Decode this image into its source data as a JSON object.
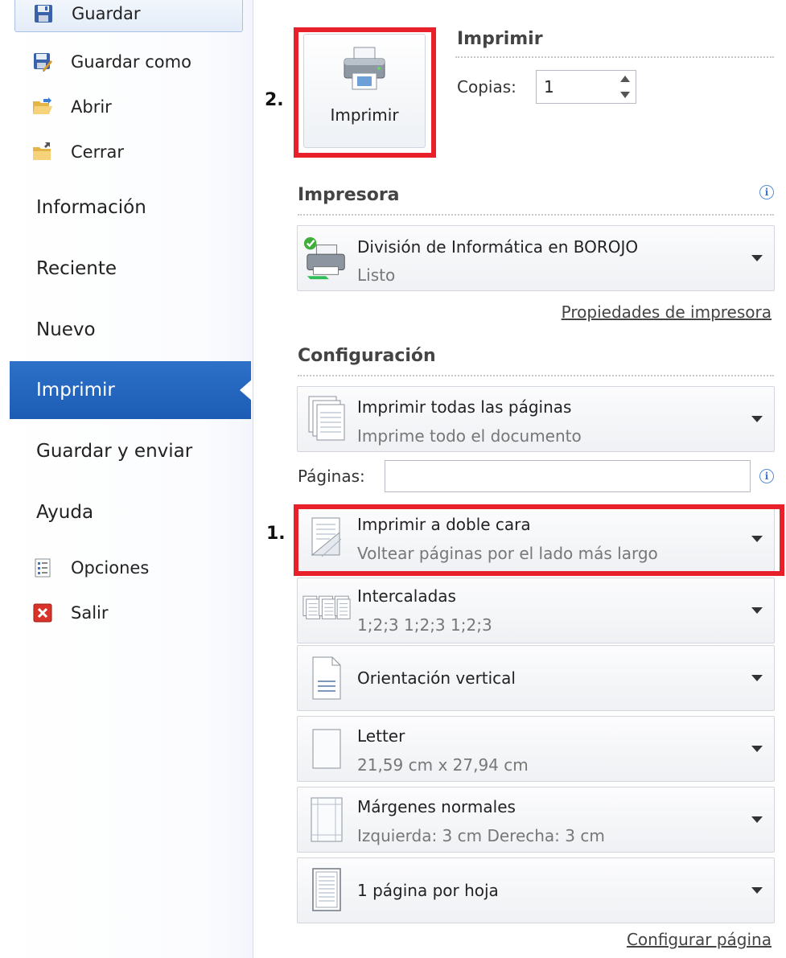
{
  "sidebar": {
    "commands": [
      {
        "label": "Guardar",
        "icon": "save-icon"
      },
      {
        "label": "Guardar como",
        "icon": "save-as-icon"
      },
      {
        "label": "Abrir",
        "icon": "open-folder-icon"
      },
      {
        "label": "Cerrar",
        "icon": "close-folder-icon"
      }
    ],
    "tabs": [
      {
        "label": "Información"
      },
      {
        "label": "Reciente"
      },
      {
        "label": "Nuevo"
      },
      {
        "label": "Imprimir"
      },
      {
        "label": "Guardar y enviar"
      },
      {
        "label": "Ayuda"
      }
    ],
    "footer": [
      {
        "label": "Opciones",
        "icon": "options-icon"
      },
      {
        "label": "Salir",
        "icon": "exit-icon"
      }
    ]
  },
  "print": {
    "section_title": "Imprimir",
    "button_label": "Imprimir",
    "copies_label": "Copias:",
    "copies_value": "1"
  },
  "printer": {
    "section_title": "Impresora",
    "name": "División de Informática en BOROJO",
    "status": "Listo",
    "properties_link": "Propiedades de impresora"
  },
  "settings": {
    "section_title": "Configuración",
    "pages_label": "Páginas:",
    "pages_value": "",
    "options": [
      {
        "main": "Imprimir todas las páginas",
        "sub": "Imprime todo el documento",
        "icon": "all-pages-icon"
      },
      {
        "main": "Imprimir a doble cara",
        "sub": "Voltear páginas por el lado más largo",
        "icon": "duplex-icon"
      },
      {
        "main": "Intercaladas",
        "sub": "1;2;3    1;2;3    1;2;3",
        "icon": "collated-icon"
      },
      {
        "main": "Orientación vertical",
        "sub": "",
        "icon": "portrait-icon"
      },
      {
        "main": "Letter",
        "sub": "21,59 cm x 27,94 cm",
        "icon": "paper-size-icon"
      },
      {
        "main": "Márgenes normales",
        "sub": "Izquierda:  3 cm    Derecha:  3 cm",
        "icon": "margins-icon"
      },
      {
        "main": "1 página por hoja",
        "sub": "",
        "icon": "pages-per-sheet-icon"
      }
    ],
    "page_setup_link": "Configurar página"
  },
  "annotations": {
    "step1": "1.",
    "step2": "2.",
    "highlight_color": "#e8202a"
  },
  "colors": {
    "active_tab": "#2566bf"
  }
}
